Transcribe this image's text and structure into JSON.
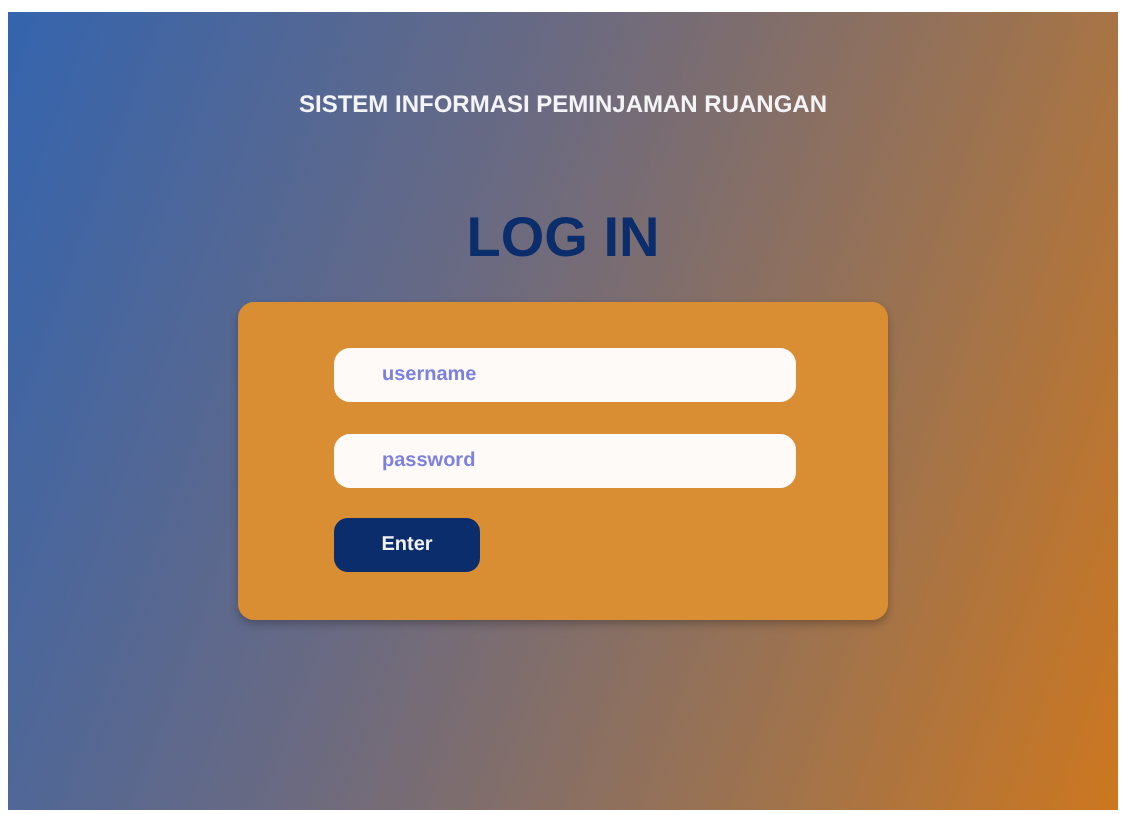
{
  "header": {
    "title": "SISTEM INFORMASI PEMINJAMAN RUANGAN"
  },
  "login": {
    "heading": "LOG IN",
    "fields": [
      {
        "placeholder": "username"
      },
      {
        "placeholder": "password"
      }
    ],
    "button": "Enter"
  }
}
